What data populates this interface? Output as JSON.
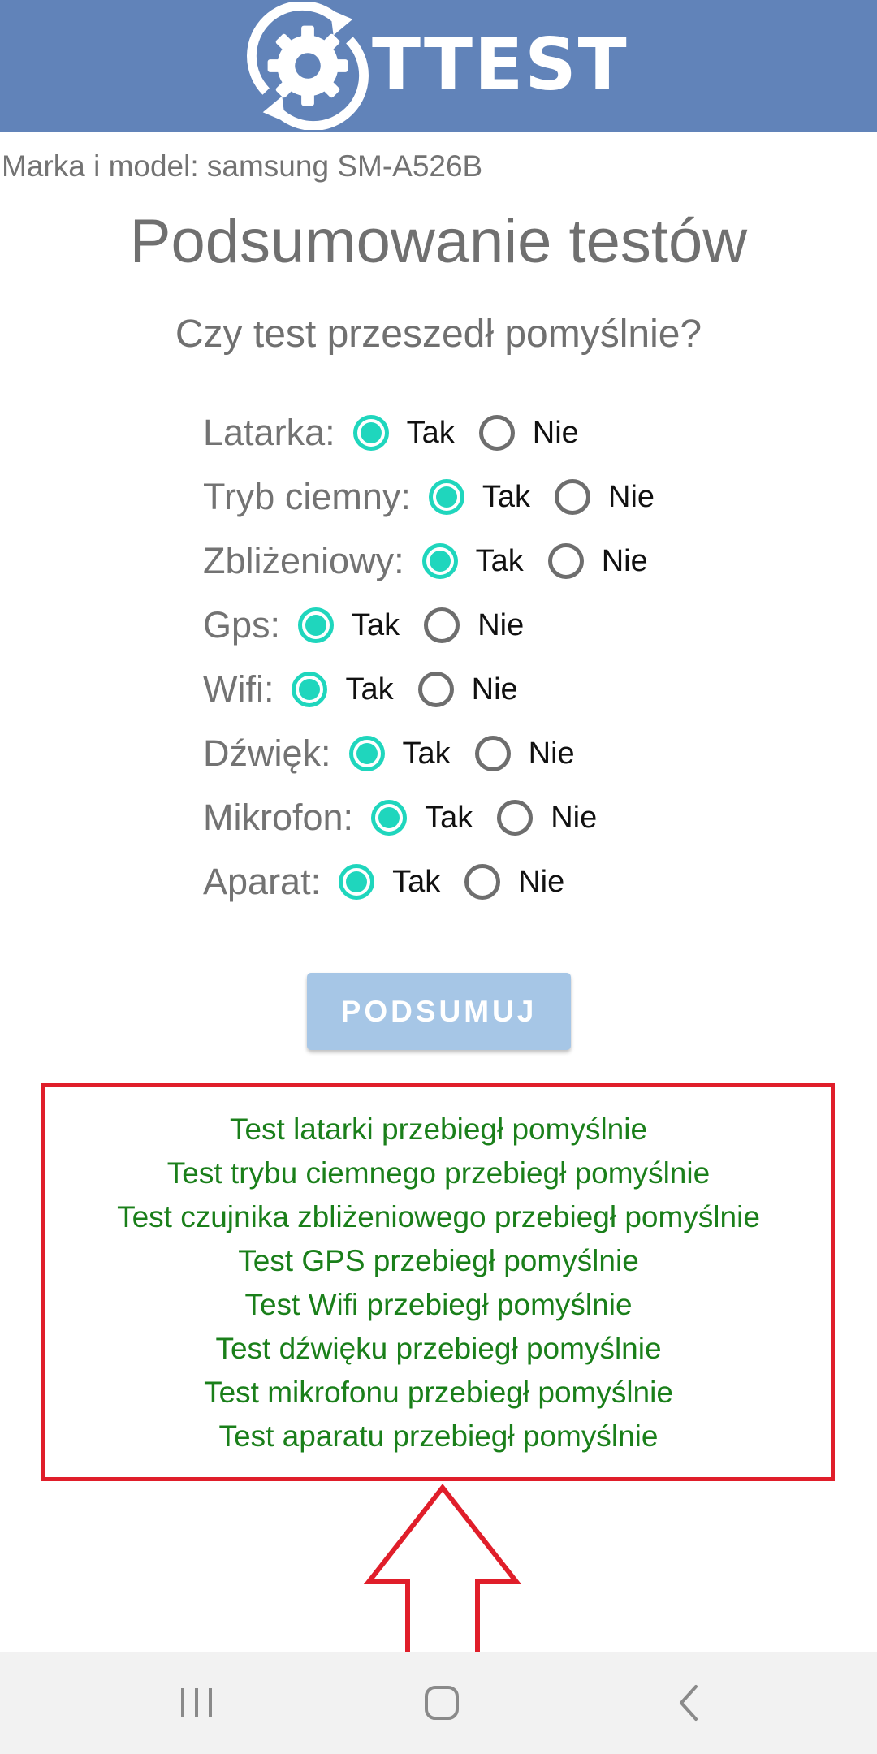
{
  "app": {
    "logo_text": "TTEST",
    "header_color": "#6183b9"
  },
  "device": {
    "model_label": "Marka i model: samsung SM-A526B"
  },
  "summary": {
    "title": "Podsumowanie testów",
    "question": "Czy test przeszedł pomyślnie?",
    "yes_label": "Tak",
    "no_label": "Nie",
    "tests": [
      {
        "label": "Latarka:",
        "selected": "Tak"
      },
      {
        "label": "Tryb ciemny:",
        "selected": "Tak"
      },
      {
        "label": "Zbliżeniowy:",
        "selected": "Tak"
      },
      {
        "label": "Gps:",
        "selected": "Tak"
      },
      {
        "label": "Wifi:",
        "selected": "Tak"
      },
      {
        "label": "Dźwięk:",
        "selected": "Tak"
      },
      {
        "label": "Mikrofon:",
        "selected": "Tak"
      },
      {
        "label": "Aparat:",
        "selected": "Tak"
      }
    ],
    "button_label": "PODSUMUJ"
  },
  "results": [
    "Test latarki przebiegł pomyślnie",
    "Test trybu ciemnego przebiegł pomyślnie",
    "Test czujnika zbliżeniowego przebiegł pomyślnie",
    "Test GPS przebiegł pomyślnie",
    "Test Wifi przebiegł pomyślnie",
    "Test dźwięku przebiegł pomyślnie",
    "Test mikrofonu przebiegł pomyślnie",
    "Test aparatu przebiegł pomyślnie"
  ],
  "colors": {
    "radio_accent": "#1fd6bd",
    "result_text": "#1a7f1a",
    "annotation_red": "#e01e2a",
    "button_bg": "#a6c6e6"
  },
  "navigation": {
    "icons": [
      "recent-apps-icon",
      "home-icon",
      "back-icon"
    ]
  }
}
